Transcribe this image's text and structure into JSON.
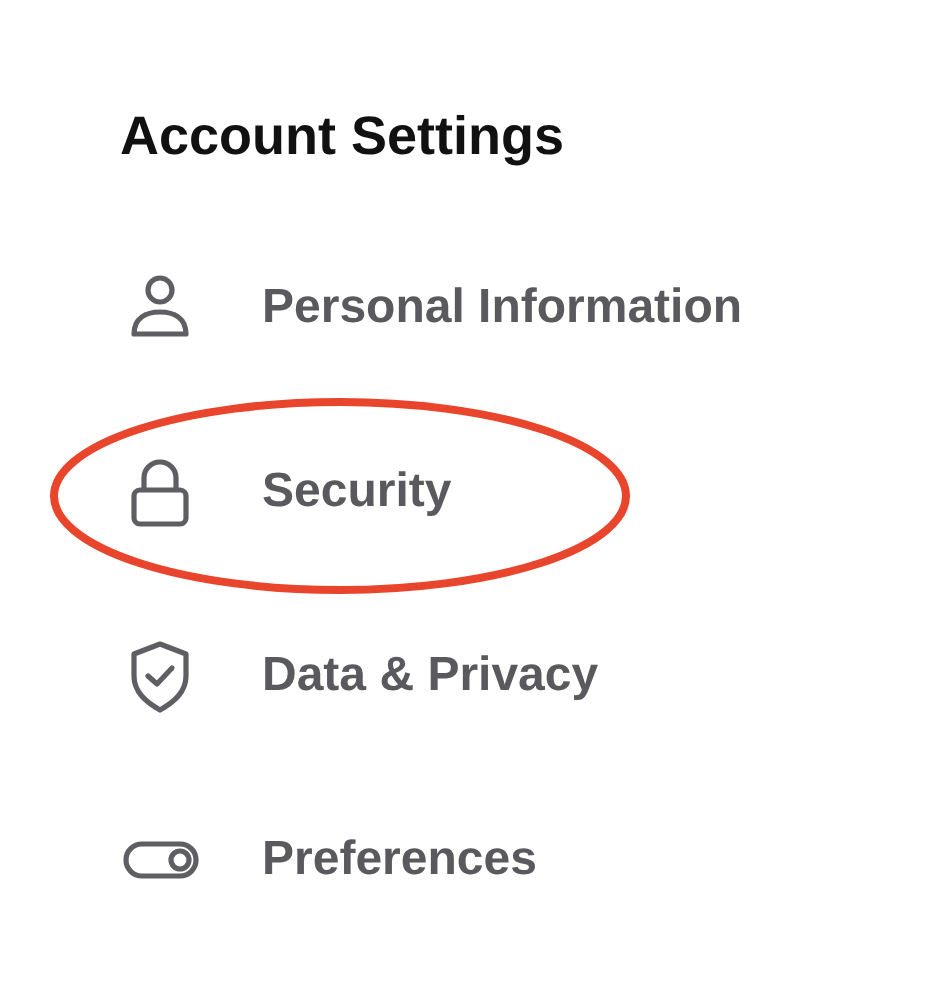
{
  "title": "Account Settings",
  "items": [
    {
      "label": "Personal Information",
      "circled": false
    },
    {
      "label": "Security",
      "circled": true
    },
    {
      "label": "Data & Privacy",
      "circled": false
    },
    {
      "label": "Preferences",
      "circled": false
    }
  ]
}
